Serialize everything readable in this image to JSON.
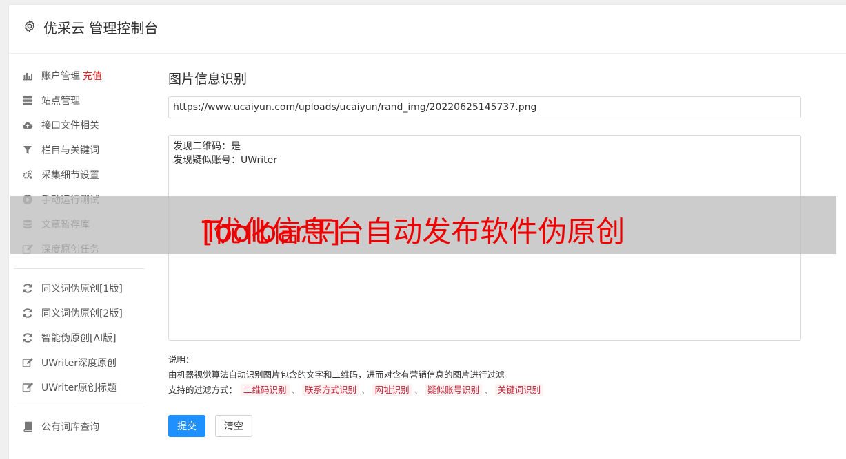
{
  "header": {
    "title": "优采云 管理控制台",
    "icon": "gear-icon"
  },
  "sidebar": {
    "group1": [
      {
        "label": "账户管理",
        "badge": "充值",
        "icon": "bar-chart-icon"
      },
      {
        "label": "站点管理",
        "icon": "server-icon"
      },
      {
        "label": "接口文件相关",
        "icon": "cloud-upload-icon"
      },
      {
        "label": "栏目与关键词",
        "icon": "filter-icon"
      },
      {
        "label": "采集细节设置",
        "icon": "gears-icon"
      },
      {
        "label": "手动运行测试",
        "icon": "play-circle-icon"
      },
      {
        "label": "文章暂存库",
        "icon": "database-icon"
      },
      {
        "label": "深度原创任务",
        "icon": "edit-icon"
      }
    ],
    "group2": [
      {
        "label": "同义词伪原创[1版]",
        "icon": "refresh-icon"
      },
      {
        "label": "同义词伪原创[2版]",
        "icon": "refresh-icon"
      },
      {
        "label": "智能伪原创[AI版]",
        "icon": "refresh-icon"
      },
      {
        "label": "UWriter深度原创",
        "icon": "edit-icon"
      },
      {
        "label": "UWriter原创标题",
        "icon": "edit-icon"
      }
    ],
    "group3": [
      {
        "label": "公有词库查询",
        "icon": "book-icon"
      }
    ]
  },
  "main": {
    "heading": "图片信息识别",
    "url_value": "https://www.ucaiyun.com/uploads/ucaiyun/rand_img/20220625145737.png",
    "result_lines": [
      "发现二维码：是",
      "发现疑似账号：UWriter"
    ],
    "notes": {
      "title": "说明：",
      "description": "由机器视觉算法自动识别图片包含的文字和二维码，进而对含有营销信息的图片进行过滤。",
      "methods_label": "支持的过滤方式：",
      "tags": [
        "二维码识别",
        "联系方式识别",
        "网址识别",
        "疑似账号识别",
        "关键词识别"
      ],
      "separator": "、"
    },
    "submit_label": "提交",
    "clear_label": "清空"
  },
  "overlay": {
    "text_a": "[优化信息]",
    "text_b": "Toolbar平台自动发布软件伪原创"
  },
  "colors": {
    "accent": "#1e90ff",
    "badge": "#e02020",
    "tag_text": "#c0263a",
    "tag_bg": "#fdf1f2",
    "overlay_text": "#ee0000"
  }
}
